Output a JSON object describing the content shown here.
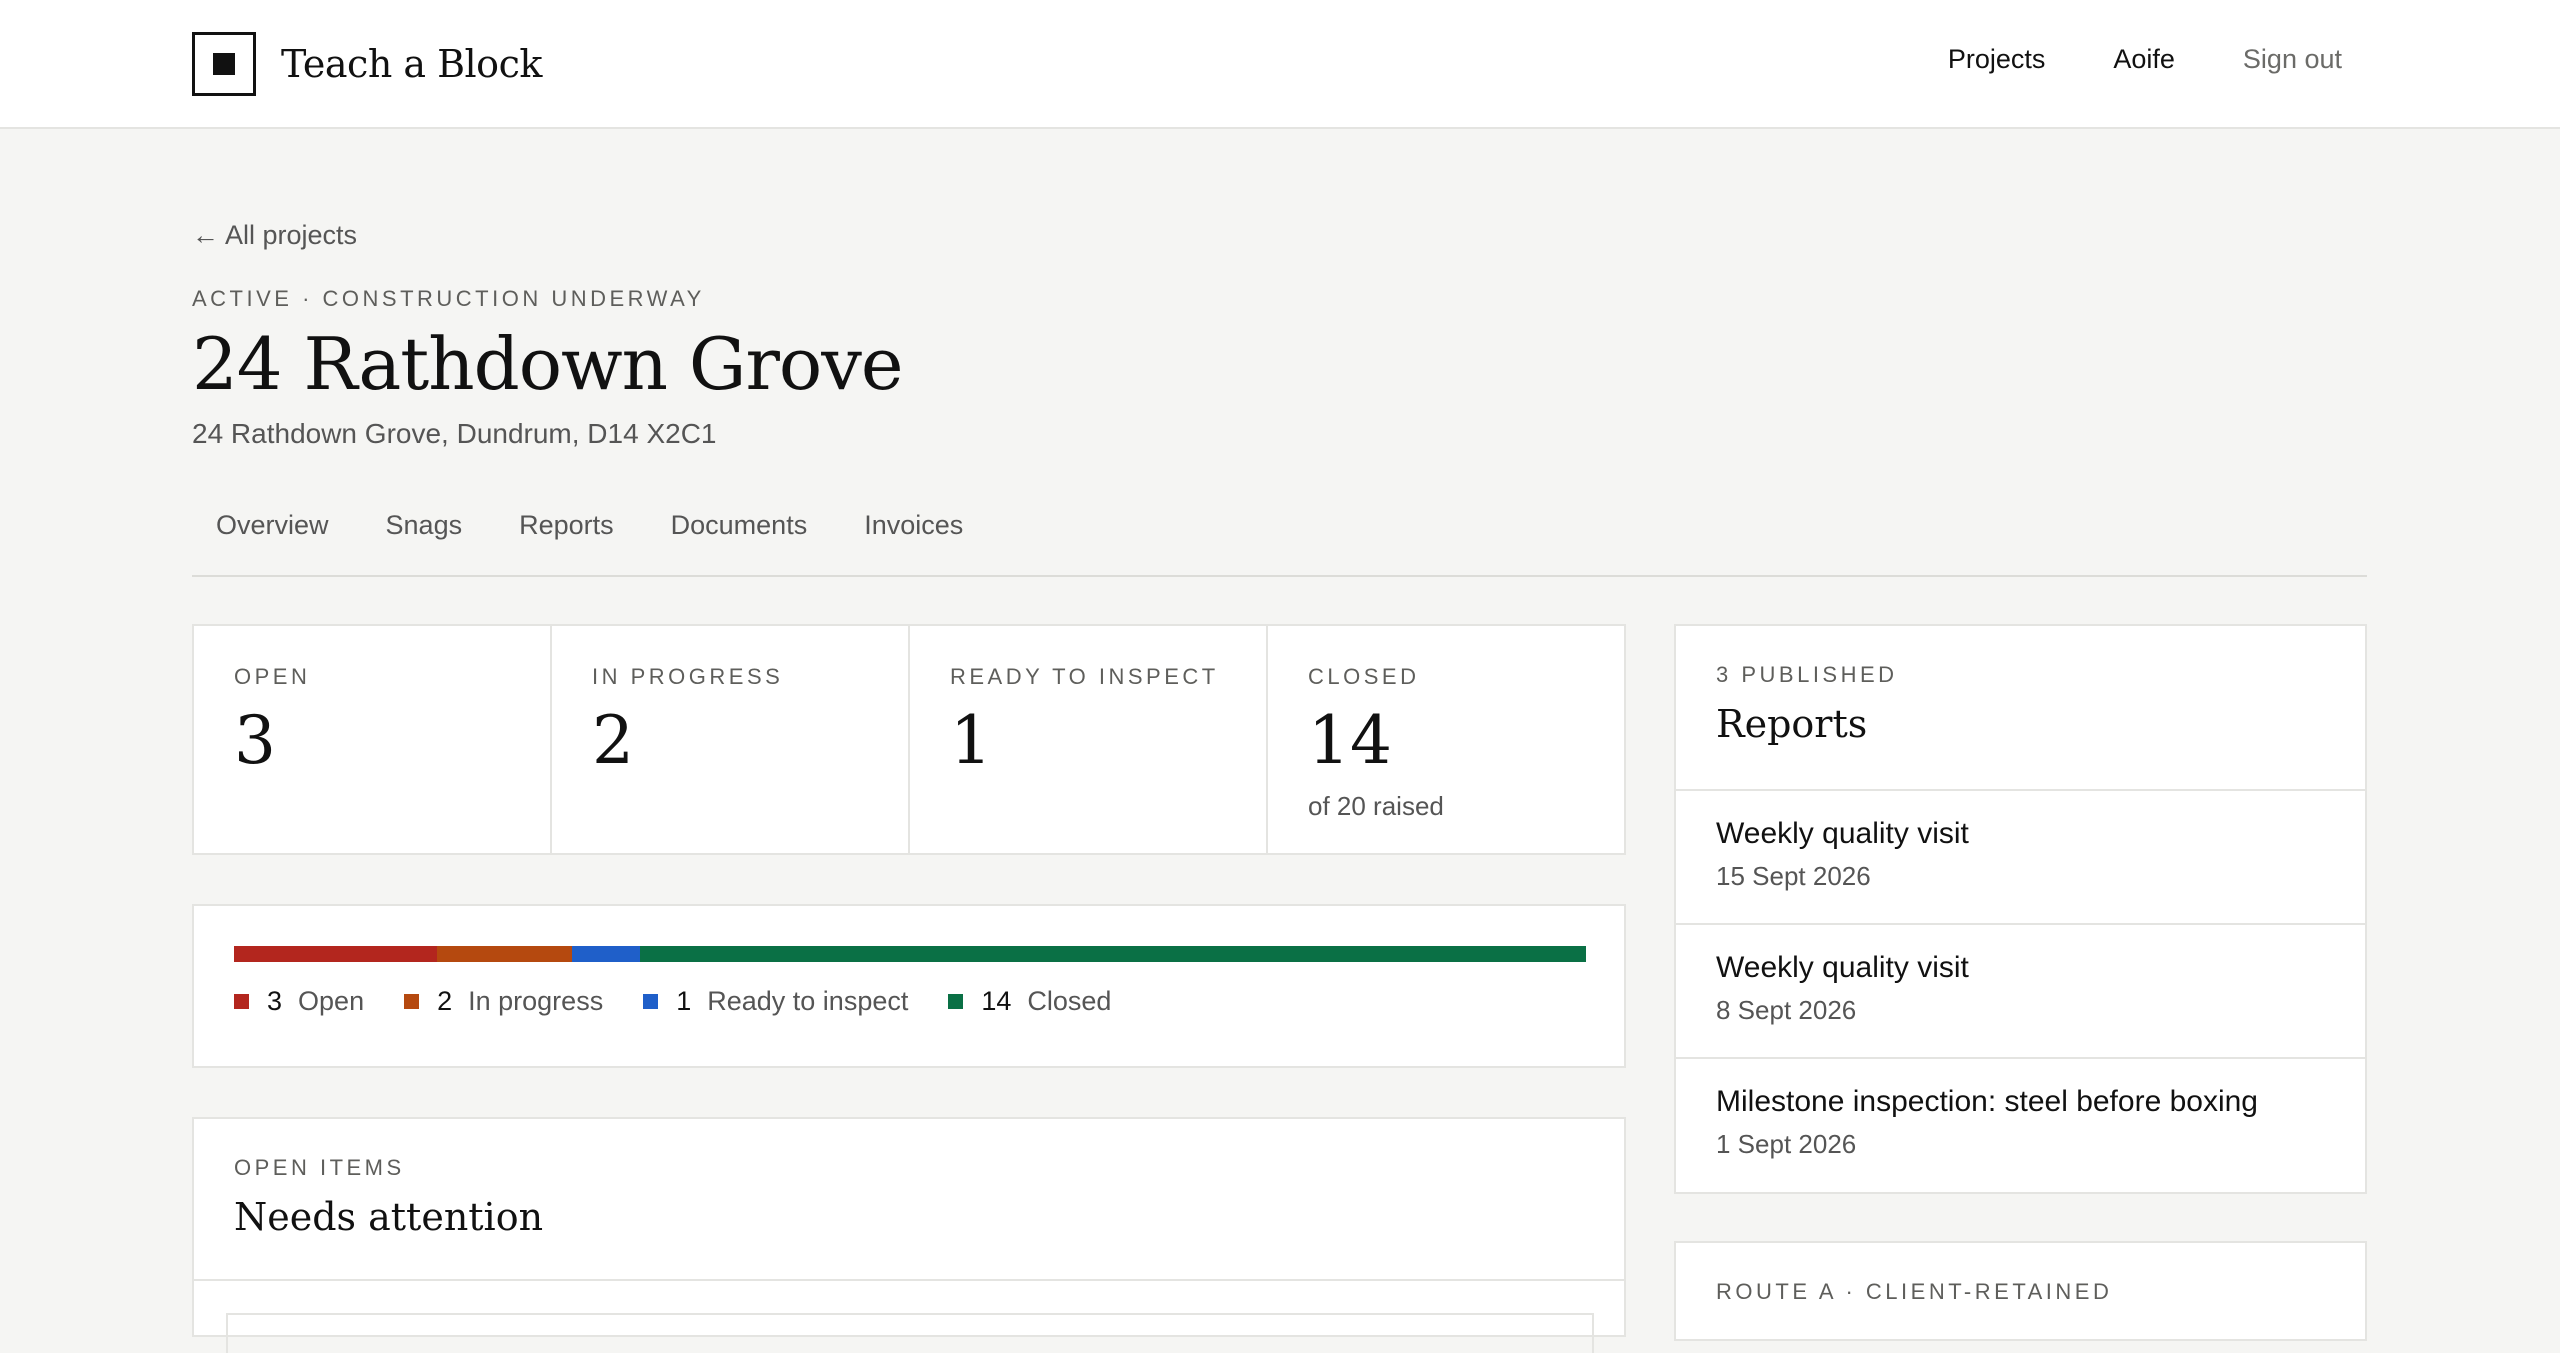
{
  "app": {
    "name": "Teach a Block"
  },
  "nav": {
    "projects": "Projects",
    "user": "Aoife",
    "sign_out": "Sign out"
  },
  "back_link": "← All projects",
  "project": {
    "status": "ACTIVE · CONSTRUCTION UNDERWAY",
    "title": "24 Rathdown Grove",
    "address": "24 Rathdown Grove, Dundrum, D14 X2C1"
  },
  "tabs": [
    "Overview",
    "Snags",
    "Reports",
    "Documents",
    "Invoices"
  ],
  "stats": [
    {
      "label": "OPEN",
      "value": "3",
      "sub": ""
    },
    {
      "label": "IN PROGRESS",
      "value": "2",
      "sub": ""
    },
    {
      "label": "READY TO INSPECT",
      "value": "1",
      "sub": ""
    },
    {
      "label": "CLOSED",
      "value": "14",
      "sub": "of 20 raised"
    }
  ],
  "progress": {
    "total": 20,
    "segments": [
      {
        "count": 3,
        "label": "Open",
        "color": "#b3261e"
      },
      {
        "count": 2,
        "label": "In progress",
        "color": "#b5490f"
      },
      {
        "count": 1,
        "label": "Ready to inspect",
        "color": "#1f5fc9"
      },
      {
        "count": 14,
        "label": "Closed",
        "color": "#0a7045"
      }
    ]
  },
  "open_items": {
    "eyebrow": "OPEN ITEMS",
    "title": "Needs attention"
  },
  "reports": {
    "eyebrow": "3 PUBLISHED",
    "title": "Reports",
    "items": [
      {
        "title": "Weekly quality visit",
        "date": "15 Sept 2026"
      },
      {
        "title": "Weekly quality visit",
        "date": "8 Sept 2026"
      },
      {
        "title": "Milestone inspection: steel before boxing",
        "date": "1 Sept 2026"
      }
    ]
  },
  "route": {
    "eyebrow": "ROUTE A · CLIENT-RETAINED"
  }
}
